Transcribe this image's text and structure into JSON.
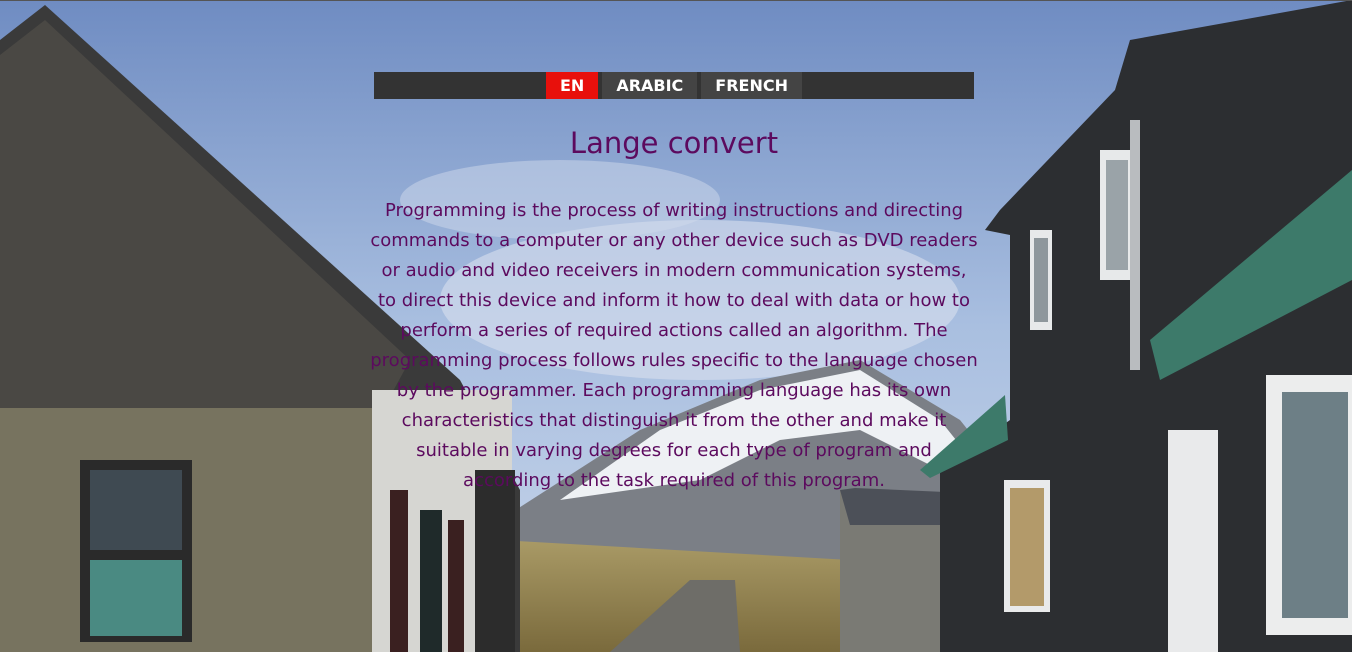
{
  "language_bar": {
    "buttons": [
      {
        "label": "EN",
        "active": true
      },
      {
        "label": "ARABIC",
        "active": false
      },
      {
        "label": "FRENCH",
        "active": false
      }
    ]
  },
  "main": {
    "title": "Lange convert",
    "paragraph": "Programming is the process of writing instructions and directing commands to a computer or any other device such as DVD readers or audio and video receivers in modern communication systems, to direct this device and inform it how to deal with data or how to perform a series of required actions called an algorithm. The programming process follows rules specific to the language chosen by the programmer. Each programming language has its own characteristics that distinguish it from the other and make it suitable in varying degrees for each type of program and according to the task required of this program."
  },
  "colors": {
    "active_button": "#e8100c",
    "bar_background": "#333333",
    "text": "#5c0a5e"
  }
}
